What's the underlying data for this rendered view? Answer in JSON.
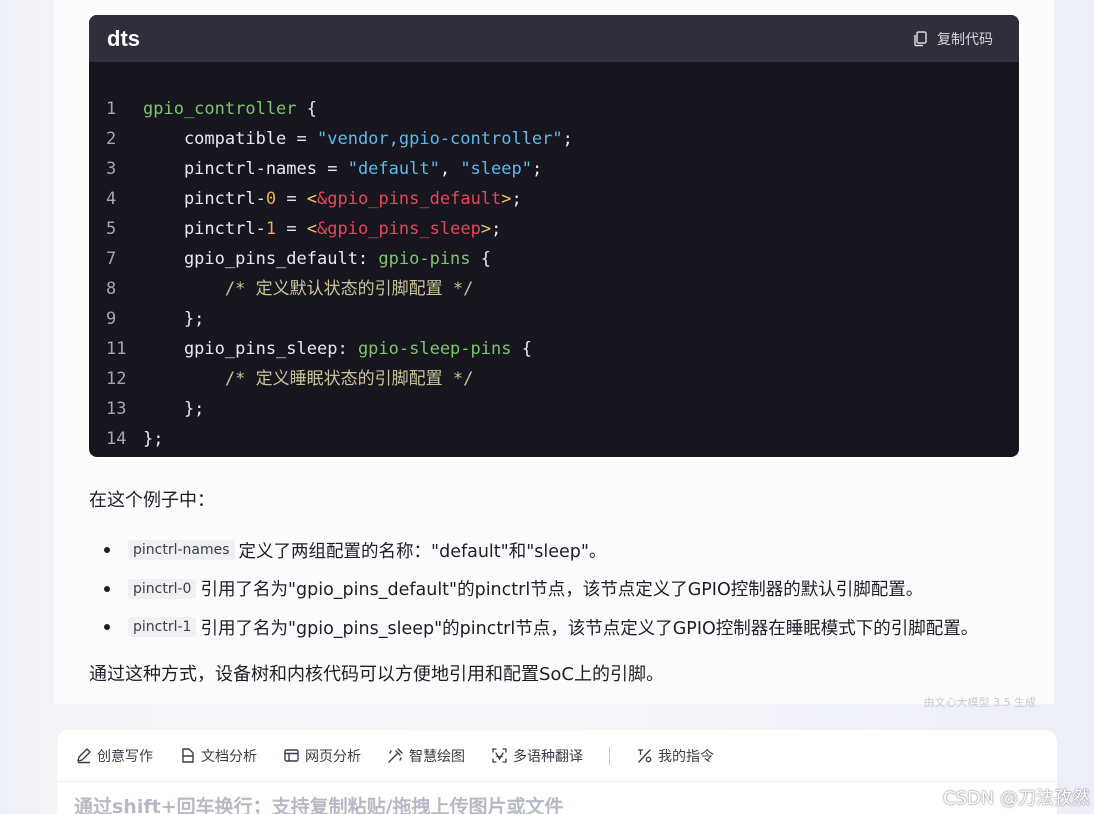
{
  "code_block": {
    "language": "dts",
    "copy_label": "复制代码",
    "lines": [
      {
        "n": "1",
        "tokens": [
          {
            "t": "gpio_controller",
            "c": "green"
          },
          {
            "t": " {",
            "c": "plain"
          }
        ]
      },
      {
        "n": "2",
        "tokens": [
          {
            "t": "    compatible = ",
            "c": "plain"
          },
          {
            "t": "\"vendor,gpio-controller\"",
            "c": "str"
          },
          {
            "t": ";",
            "c": "plain"
          }
        ]
      },
      {
        "n": "3",
        "tokens": [
          {
            "t": "    pinctrl-names = ",
            "c": "plain"
          },
          {
            "t": "\"default\"",
            "c": "str"
          },
          {
            "t": ", ",
            "c": "plain"
          },
          {
            "t": "\"sleep\"",
            "c": "str"
          },
          {
            "t": ";",
            "c": "plain"
          }
        ]
      },
      {
        "n": "4",
        "tokens": [
          {
            "t": "    pinctrl-",
            "c": "plain"
          },
          {
            "t": "0",
            "c": "num"
          },
          {
            "t": " = ",
            "c": "plain"
          },
          {
            "t": "<",
            "c": "op"
          },
          {
            "t": "&gpio_pins_default",
            "c": "ref"
          },
          {
            "t": ">",
            "c": "op"
          },
          {
            "t": ";",
            "c": "plain"
          }
        ]
      },
      {
        "n": "5",
        "tokens": [
          {
            "t": "    pinctrl-",
            "c": "plain"
          },
          {
            "t": "1",
            "c": "num"
          },
          {
            "t": " = ",
            "c": "plain"
          },
          {
            "t": "<",
            "c": "op"
          },
          {
            "t": "&gpio_pins_sleep",
            "c": "ref"
          },
          {
            "t": ">",
            "c": "op"
          },
          {
            "t": ";",
            "c": "plain"
          }
        ]
      },
      {
        "n": "7",
        "tokens": [
          {
            "t": "    gpio_pins_default: ",
            "c": "plain"
          },
          {
            "t": "gpio-pins",
            "c": "green"
          },
          {
            "t": " {",
            "c": "plain"
          }
        ]
      },
      {
        "n": "8",
        "tokens": [
          {
            "t": "        ",
            "c": "plain"
          },
          {
            "t": "/* 定义默认状态的引脚配置 */",
            "c": "comment"
          }
        ]
      },
      {
        "n": "9",
        "tokens": [
          {
            "t": "    };",
            "c": "plain"
          }
        ]
      },
      {
        "n": "11",
        "tokens": [
          {
            "t": "    gpio_pins_sleep: ",
            "c": "plain"
          },
          {
            "t": "gpio-sleep-pins",
            "c": "green"
          },
          {
            "t": " {",
            "c": "plain"
          }
        ]
      },
      {
        "n": "12",
        "tokens": [
          {
            "t": "        ",
            "c": "plain"
          },
          {
            "t": "/* 定义睡眠状态的引脚配置 */",
            "c": "comment"
          }
        ]
      },
      {
        "n": "13",
        "tokens": [
          {
            "t": "    };",
            "c": "plain"
          }
        ]
      },
      {
        "n": "14",
        "tokens": [
          {
            "t": "};",
            "c": "plain"
          }
        ]
      }
    ]
  },
  "content": {
    "intro": "在这个例子中：",
    "bullets": [
      {
        "code": "pinctrl-names",
        "text": "定义了两组配置的名称：\"default\"和\"sleep\"。"
      },
      {
        "code": "pinctrl-0",
        "text": "引用了名为\"gpio_pins_default\"的pinctrl节点，该节点定义了GPIO控制器的默认引脚配置。"
      },
      {
        "code": "pinctrl-1",
        "text": "引用了名为\"gpio_pins_sleep\"的pinctrl节点，该节点定义了GPIO控制器在睡眠模式下的引脚配置。"
      }
    ],
    "conclusion": "通过这种方式，设备树和内核代码可以方便地引用和配置SoC上的引脚。",
    "generated_by": "由文心大模型 3.5 生成"
  },
  "input_area": {
    "tools": [
      {
        "label": "创意写作",
        "icon": "pen-icon"
      },
      {
        "label": "文档分析",
        "icon": "document-icon"
      },
      {
        "label": "网页分析",
        "icon": "webpage-icon"
      },
      {
        "label": "智慧绘图",
        "icon": "paint-brush-icon"
      },
      {
        "label": "多语种翻译",
        "icon": "translate-icon"
      }
    ],
    "my_commands_label": "我的指令",
    "my_commands_icon": "percent-slash-icon",
    "placeholder": "通过shift+回车换行；支持复制粘贴/拖拽上传图片或文件"
  },
  "watermark": "CSDN @刀法孜然",
  "colors": {
    "code_bg": "#17161f",
    "code_header_bg": "#2f2e3a",
    "token_green": "#7dc56f",
    "token_string": "#5cb9ea",
    "token_number": "#e8b040",
    "token_reference": "#e5465e",
    "token_comment": "#c9c29a"
  }
}
